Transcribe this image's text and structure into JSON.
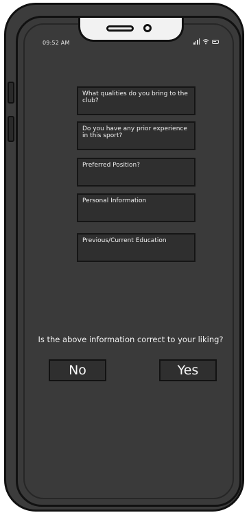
{
  "status_bar": {
    "time": "09:52 AM"
  },
  "form": {
    "fields": [
      {
        "label": "What qualities do you bring to the club?"
      },
      {
        "label": "Do you have any prior experience in this sport?"
      },
      {
        "label": "Preferred Position?"
      },
      {
        "label": "Personal Information"
      },
      {
        "label": "Previous/Current Education"
      }
    ]
  },
  "confirmation": {
    "question": "Is the above information correct to your liking?",
    "no_label": "No",
    "yes_label": "Yes"
  },
  "icons": {
    "signal": "signal-icon",
    "wifi": "wifi-icon",
    "battery": "battery-icon"
  },
  "colors": {
    "screen_background": "#3a3a3a",
    "field_background": "#2f2f2f",
    "text": "#f0f0f0"
  }
}
